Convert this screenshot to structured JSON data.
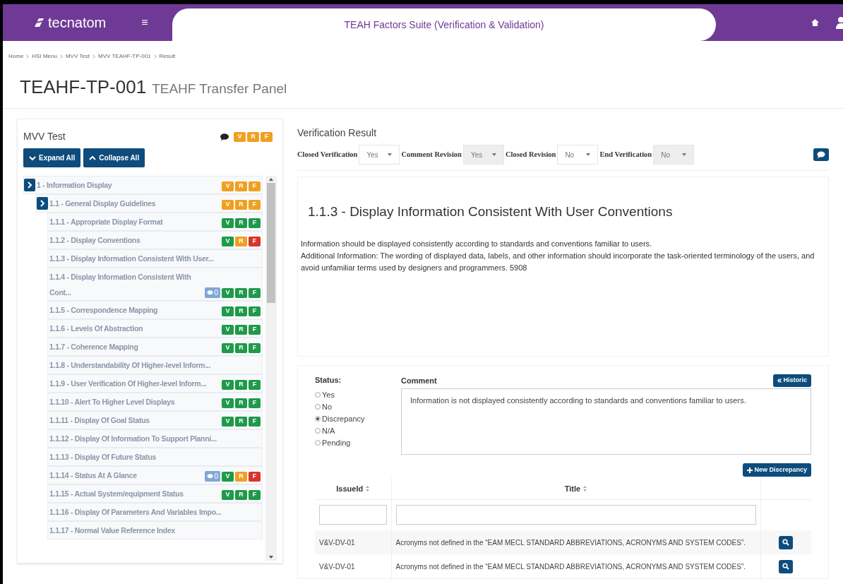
{
  "header": {
    "logo": "tecnatom",
    "menu_glyph": "≡",
    "title": "TEAH Factors Suite (Verification & Validation)"
  },
  "breadcrumbs": [
    "Home",
    "HSI Menu",
    "MVV Test",
    "MVV TEAHF-TP-001",
    "Result"
  ],
  "page": {
    "code": "TEAHF-TP-001",
    "name": "TEAHF Transfer Panel"
  },
  "tree_panel": {
    "title": "MVV Test",
    "badges": [
      {
        "letter": "V",
        "color": "#f0a020"
      },
      {
        "letter": "R",
        "color": "#f0a020"
      },
      {
        "letter": "F",
        "color": "#f0a020"
      }
    ],
    "buttons": [
      "Expand All",
      "Collapse All"
    ],
    "tree": [
      {
        "label": "1 - Information Display",
        "badges": [
          {
            "letter": "V",
            "color": "#f0a020"
          },
          {
            "letter": "R",
            "color": "#f0a020"
          },
          {
            "letter": "F",
            "color": "#f0a020"
          }
        ],
        "children": [
          {
            "label": "1.1 - General Display Guidelines",
            "badges": [
              {
                "letter": "V",
                "color": "#f0a020"
              },
              {
                "letter": "R",
                "color": "#f0a020"
              },
              {
                "letter": "F",
                "color": "#f0a020"
              }
            ],
            "children": [
              {
                "label": "1.1.1 - Appropriate Display Format",
                "badges": [
                  {
                    "letter": "V",
                    "color": "#1e9a4a"
                  },
                  {
                    "letter": "R",
                    "color": "#1e9a4a"
                  },
                  {
                    "letter": "F",
                    "color": "#1e9a4a"
                  }
                ]
              },
              {
                "label": "1.1.2 - Display Conventions",
                "badges": [
                  {
                    "letter": "V",
                    "color": "#1e9a4a"
                  },
                  {
                    "letter": "R",
                    "color": "#f0a020"
                  },
                  {
                    "letter": "F",
                    "color": "#d9342b"
                  }
                ]
              },
              {
                "label": "1.1.3 - Display Information Consistent With User..."
              },
              {
                "label": "1.1.4 - Display Information Consistent With Cont...",
                "comments": "0",
                "badges": [
                  {
                    "letter": "V",
                    "color": "#1e9a4a"
                  },
                  {
                    "letter": "R",
                    "color": "#1e9a4a"
                  },
                  {
                    "letter": "F",
                    "color": "#1e9a4a"
                  }
                ]
              },
              {
                "label": "1.1.5 - Correspondence Mapping",
                "badges": [
                  {
                    "letter": "V",
                    "color": "#1e9a4a"
                  },
                  {
                    "letter": "R",
                    "color": "#1e9a4a"
                  },
                  {
                    "letter": "F",
                    "color": "#1e9a4a"
                  }
                ]
              },
              {
                "label": "1.1.6 - Levels Of Abstraction",
                "badges": [
                  {
                    "letter": "V",
                    "color": "#1e9a4a"
                  },
                  {
                    "letter": "R",
                    "color": "#1e9a4a"
                  },
                  {
                    "letter": "F",
                    "color": "#1e9a4a"
                  }
                ]
              },
              {
                "label": "1.1.7 - Coherence Mapping",
                "badges": [
                  {
                    "letter": "V",
                    "color": "#1e9a4a"
                  },
                  {
                    "letter": "R",
                    "color": "#1e9a4a"
                  },
                  {
                    "letter": "F",
                    "color": "#1e9a4a"
                  }
                ]
              },
              {
                "label": "1.1.8 - Understandability Of Higher-level Inform..."
              },
              {
                "label": "1.1.9 - User Verification Of Higher-level Inform...",
                "badges": [
                  {
                    "letter": "V",
                    "color": "#1e9a4a"
                  },
                  {
                    "letter": "R",
                    "color": "#1e9a4a"
                  },
                  {
                    "letter": "F",
                    "color": "#1e9a4a"
                  }
                ]
              },
              {
                "label": "1.1.10 - Alert To Higher Level Displays",
                "badges": [
                  {
                    "letter": "V",
                    "color": "#1e9a4a"
                  },
                  {
                    "letter": "R",
                    "color": "#1e9a4a"
                  },
                  {
                    "letter": "F",
                    "color": "#1e9a4a"
                  }
                ]
              },
              {
                "label": "1.1.11 - Display Of Goal Status",
                "badges": [
                  {
                    "letter": "V",
                    "color": "#1e9a4a"
                  },
                  {
                    "letter": "R",
                    "color": "#1e9a4a"
                  },
                  {
                    "letter": "F",
                    "color": "#1e9a4a"
                  }
                ]
              },
              {
                "label": "1.1.12 - Display Of Information To Support Planni..."
              },
              {
                "label": "1.1.13 - Display Of Future Status"
              },
              {
                "label": "1.1.14 - Status At A Glance",
                "comments": "0",
                "badges": [
                  {
                    "letter": "V",
                    "color": "#1e9a4a"
                  },
                  {
                    "letter": "R",
                    "color": "#f0a020"
                  },
                  {
                    "letter": "F",
                    "color": "#d9342b"
                  }
                ]
              },
              {
                "label": "1.1.15 - Actual System/equipment Status",
                "badges": [
                  {
                    "letter": "V",
                    "color": "#1e9a4a"
                  },
                  {
                    "letter": "R",
                    "color": "#1e9a4a"
                  },
                  {
                    "letter": "F",
                    "color": "#1e9a4a"
                  }
                ]
              },
              {
                "label": "1.1.16 - Display Of Parameters And Variables Impo..."
              },
              {
                "label": "1.1.17 - Normal Value Reference Index"
              }
            ]
          }
        ]
      }
    ]
  },
  "verification": {
    "title": "Verification Result",
    "fields": [
      {
        "label": "Closed Verification",
        "value": "Yes",
        "disabled": false
      },
      {
        "label": "Comment Revision",
        "value": "Yes",
        "disabled": true
      },
      {
        "label": "Closed Revision",
        "value": "No",
        "disabled": false
      },
      {
        "label": "End Verification",
        "value": "No",
        "disabled": true
      }
    ],
    "heading": "1.1.3 - Display Information Consistent With User Conventions",
    "paragraphs": [
      "Information should be displayed consistently according to standards and conventions familiar to users.",
      "Additional Information: The wording of displayed data, labels, and other information should incorporate the task-oriented terminology of the users, and avoid unfamiliar terms used by designers and programmers. 5908"
    ]
  },
  "status": {
    "label": "Status:",
    "options": [
      {
        "label": "Yes",
        "selected": false
      },
      {
        "label": "No",
        "selected": false
      },
      {
        "label": "Discrepancy",
        "selected": true
      },
      {
        "label": "N/A",
        "selected": false
      },
      {
        "label": "Pending",
        "selected": false
      }
    ]
  },
  "comment": {
    "label": "Comment",
    "value": "Information is not displayed consistently according to standards and conventions familiar to users.",
    "historic_button": "Historic"
  },
  "new_button": "New Discrepancy",
  "table": {
    "columns": [
      "IssueId",
      "Title"
    ],
    "rows": [
      {
        "issue_id": "V&V-DV-01",
        "title": "Acronyms not defined in the “EAM MECL STANDARD ABBREVIATIONS, ACRONYMS AND SYSTEM CODES”."
      },
      {
        "issue_id": "V&V-DV-01",
        "title": "Acronyms not defined in the “EAM MECL STANDARD ABBREVIATIONS, ACRONYMS AND SYSTEM CODES”."
      }
    ]
  }
}
